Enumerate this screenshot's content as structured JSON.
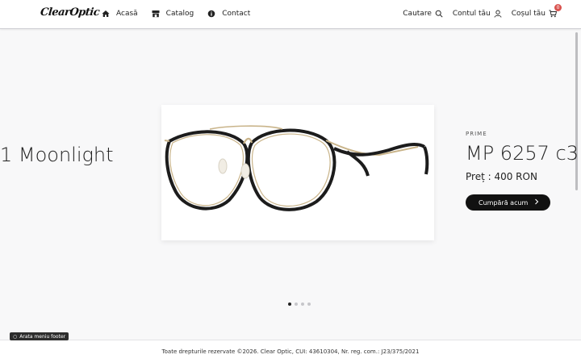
{
  "header": {
    "logo": "ClearOptic",
    "nav": [
      {
        "label": "Acasă",
        "icon": "home-icon"
      },
      {
        "label": "Catalog",
        "icon": "store-icon"
      },
      {
        "label": "Contact",
        "icon": "info-icon"
      }
    ],
    "search_label": "Cautare",
    "account_label": "Contul tău",
    "cart_label": "Coșul tău",
    "cart_count": "0"
  },
  "carousel": {
    "prev_title": "1 Moonlight",
    "brand": "PRIME",
    "product_name": "MP 6257 c3",
    "price": "Preț : 400 RON",
    "buy_label": "Cumpără acum",
    "dots": 4,
    "active_dot": 0
  },
  "footer": {
    "toggle_label": "Arata meniu footer",
    "copyright": "Toate drepturile rezervate ©2026. Clear Optic, CUI: 43610304, Nr. reg. com.: J23/375/2021"
  },
  "colors": {
    "accent": "#111111",
    "badge": "#d9534f",
    "background": "#f8f8f9"
  }
}
